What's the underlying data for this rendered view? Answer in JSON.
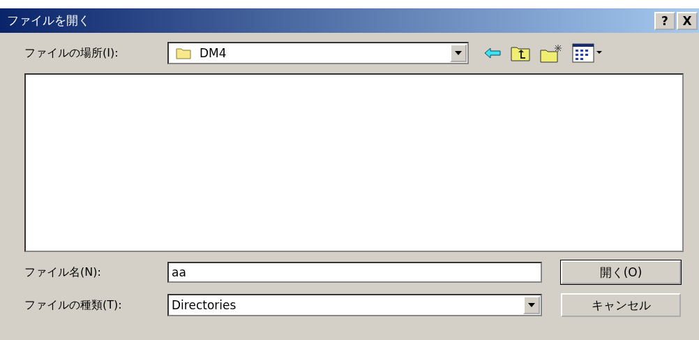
{
  "window": {
    "title": "ファイルを開く",
    "help": "?",
    "close": "X"
  },
  "location": {
    "label": "ファイルの場所(I):",
    "value": "DM4"
  },
  "file_name": {
    "label": "ファイル名(N):",
    "value": "aa"
  },
  "file_type": {
    "label": "ファイルの種類(T):",
    "value": "Directories"
  },
  "buttons": [
    {
      "label": "開く(O)",
      "default": true
    },
    {
      "label": "キャンセル",
      "default": false
    }
  ]
}
